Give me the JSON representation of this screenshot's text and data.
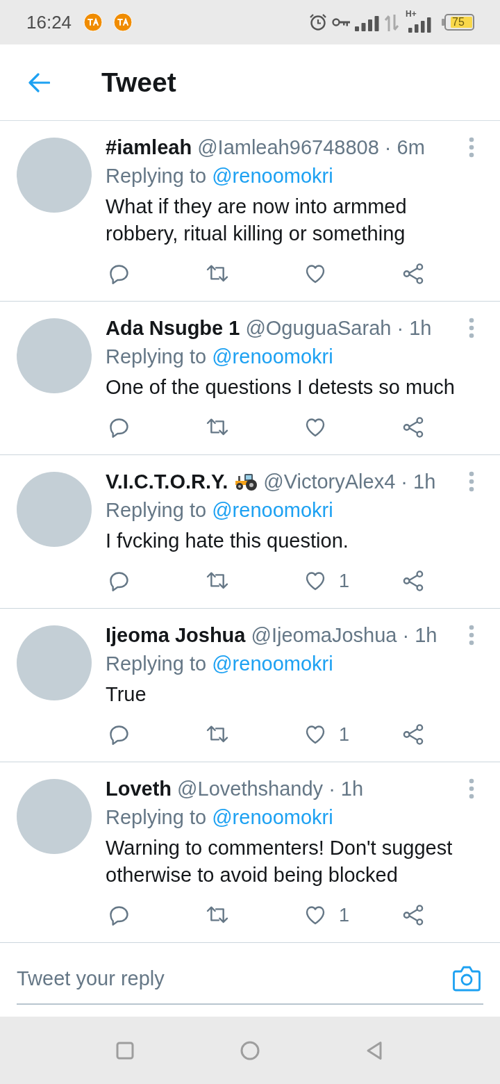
{
  "status_bar": {
    "time": "16:24",
    "network_type": "H+",
    "battery": "75"
  },
  "header": {
    "title": "Tweet"
  },
  "tweets": [
    {
      "name": "#iamleah",
      "name_emoji": false,
      "meta": "@Iamleah96748808 · 6m",
      "replying_label": "Replying to",
      "reply_to": "@renoomokri",
      "text": "What if they are now into armmed robbery, ritual killing or something"
    },
    {
      "name": "Ada Nsugbe 1",
      "name_emoji": false,
      "meta": "@OguguaSarah · 1h",
      "replying_label": "Replying to",
      "reply_to": "@renoomokri",
      "text": "One of the questions I detests so much"
    },
    {
      "name": "V.I.C.T.O.R.Y.",
      "name_emoji": true,
      "meta": "@VictoryAlex4 · 1h",
      "replying_label": "Replying to",
      "reply_to": "@renoomokri",
      "text": "I fvcking hate this question.",
      "likes": "1"
    },
    {
      "name": "Ijeoma Joshua",
      "name_emoji": false,
      "meta": "@IjeomaJoshua · 1h",
      "replying_label": "Replying to",
      "reply_to": "@renoomokri",
      "text": "True",
      "likes": "1"
    },
    {
      "name": "Loveth",
      "name_emoji": false,
      "meta": "@Lovethshandy · 1h",
      "replying_label": "Replying to",
      "reply_to": "@renoomokri",
      "text": "Warning to commenters! Don't suggest otherwise to avoid being blocked",
      "likes": "1"
    }
  ],
  "reply_box": {
    "placeholder": "Tweet your reply"
  }
}
